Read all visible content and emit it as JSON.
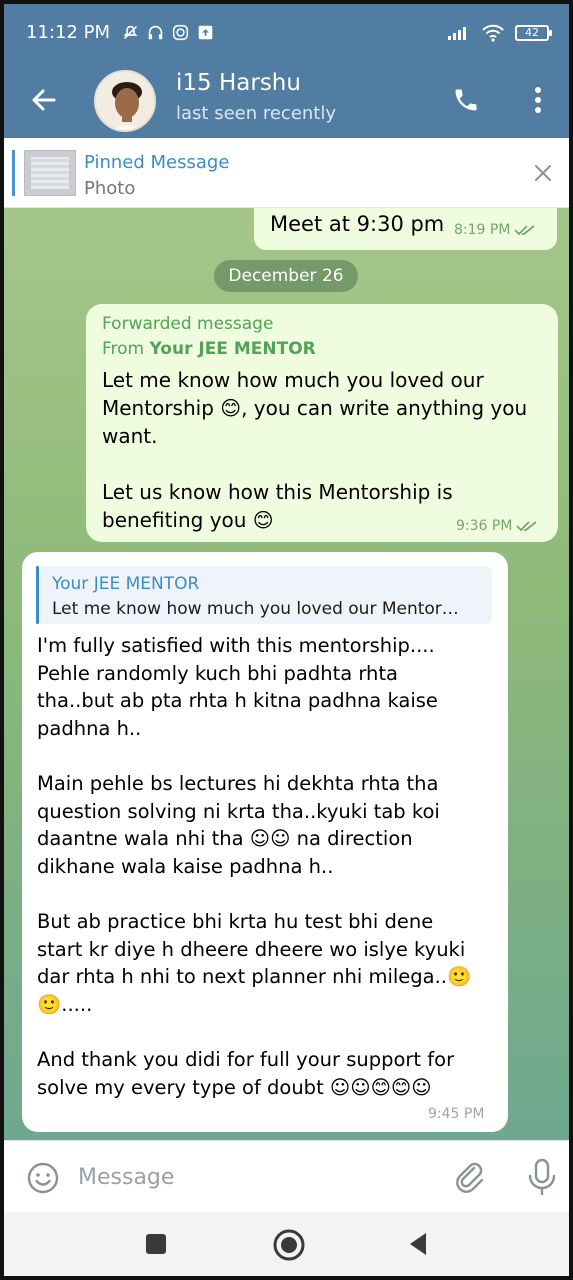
{
  "status_bar": {
    "time": "11:12 PM",
    "battery": "42",
    "icons": [
      "mute-icon",
      "headphones-icon",
      "instagram-icon",
      "upload-icon",
      "signal-icon",
      "wifi-icon",
      "battery-icon"
    ]
  },
  "header": {
    "title": "i15 Harshu",
    "subtitle": "last seen recently",
    "bar_color": "#517da2"
  },
  "pinned": {
    "title": "Pinned Message",
    "subtitle": "Photo"
  },
  "messages": {
    "partial_out": {
      "text": "Meet at 9:30 pm",
      "time": "8:19 PM"
    },
    "date_separator": "December 26",
    "forwarded": {
      "label": "Forwarded message",
      "from_prefix": "From ",
      "from_name": "Your JEE MENTOR",
      "text": "Let me know how much you loved our Mentorship 😊, you can write anything you want.\n\nLet us know how this Mentorship is benefiting you 😊",
      "time": "9:36 PM"
    },
    "reply": {
      "quote_title": "Your JEE MENTOR",
      "quote_text": "Let me know how much you loved our Mentor…",
      "text": "I'm fully satisfied with this mentorship....\nPehle randomly kuch bhi padhta rhta\ntha..but ab pta rhta h kitna padhna kaise\npadhna h..\n\nMain pehle bs lectures hi dekhta rhta tha\nquestion solving ni krta tha..kyuki tab koi\ndaantne wala nhi tha ☺☺ na direction\ndikhane wala kaise padhna h..\n\nBut ab practice bhi krta hu test bhi dene\nstart kr diye h dheere dheere wo islye kyuki\ndar rhta h nhi to next planner nhi milega..🙂\n🙂.....\n\nAnd thank you didi for full your support for\nsolve my every type of doubt ☺☺😊😊☺",
      "time": "9:45 PM"
    }
  },
  "composer": {
    "placeholder": "Message"
  }
}
